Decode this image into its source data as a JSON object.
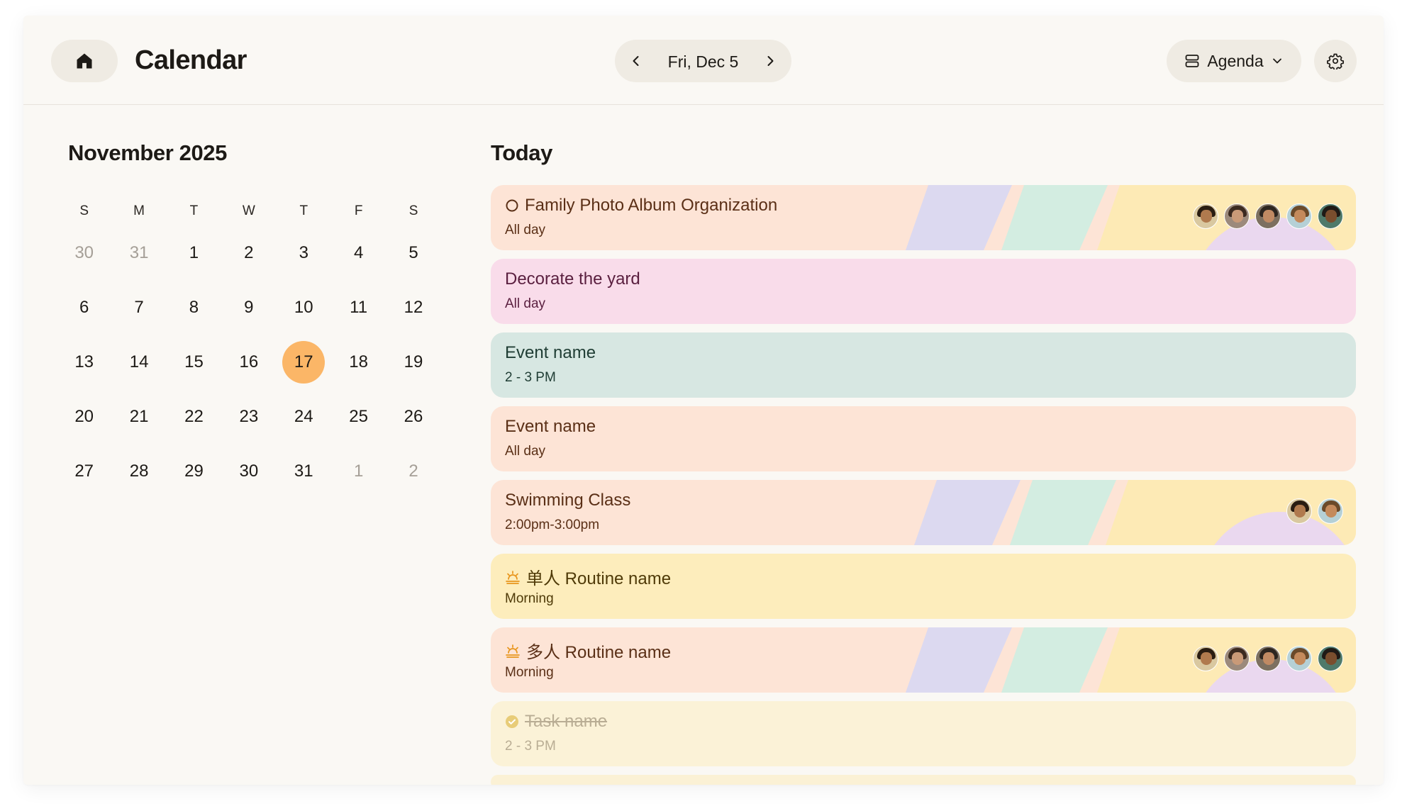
{
  "header": {
    "title": "Calendar",
    "date_label": "Fri, Dec 5",
    "view_label": "Agenda",
    "icons": {
      "home": "home-icon",
      "prev": "chevron-left-icon",
      "next": "chevron-right-icon",
      "view": "agenda-view-icon",
      "view_caret": "chevron-down-icon",
      "settings": "gear-icon"
    }
  },
  "month": {
    "title": "November 2025",
    "weekdays": [
      "S",
      "M",
      "T",
      "W",
      "T",
      "F",
      "S"
    ],
    "weeks": [
      [
        "30",
        "31",
        "1",
        "2",
        "3",
        "4",
        "5"
      ],
      [
        "6",
        "7",
        "8",
        "9",
        "10",
        "11",
        "12"
      ],
      [
        "13",
        "14",
        "15",
        "16",
        "17",
        "18",
        "19"
      ],
      [
        "20",
        "21",
        "22",
        "23",
        "24",
        "25",
        "26"
      ],
      [
        "27",
        "28",
        "29",
        "30",
        "31",
        "1",
        "2"
      ]
    ],
    "muted_days": [
      "0-0",
      "0-1",
      "4-5",
      "4-6"
    ],
    "selected_day": "17",
    "accent_color": "#fbb667"
  },
  "agenda": {
    "title": "Today",
    "events": [
      {
        "title": "Family Photo Album Organization",
        "subtitle": "All day",
        "icon": "circle-outline-icon",
        "color": "#fde4d6",
        "avatars": 5
      },
      {
        "title": "Decorate the yard",
        "subtitle": "All day",
        "color": "#f9dcea"
      },
      {
        "title": "Event name",
        "subtitle": "2 - 3 PM",
        "color": "#d7e7e2"
      },
      {
        "title": "Event name",
        "subtitle": "All day",
        "color": "#fde4d6"
      },
      {
        "title": "Swimming Class",
        "subtitle": "2:00pm-3:00pm",
        "color": "#fde4d6",
        "avatars": 2
      },
      {
        "title": "单人 Routine name",
        "subtitle": "Morning",
        "icon": "sunrise-icon",
        "color": "#fdedbc"
      },
      {
        "title": "多人 Routine name",
        "subtitle": "Morning",
        "icon": "sunrise-icon",
        "color": "#fde4d6",
        "avatars": 5
      },
      {
        "title": "Task name",
        "subtitle": "2 - 3 PM",
        "icon": "check-circle-icon",
        "completed": true,
        "color": "#fbf2d7"
      }
    ]
  }
}
